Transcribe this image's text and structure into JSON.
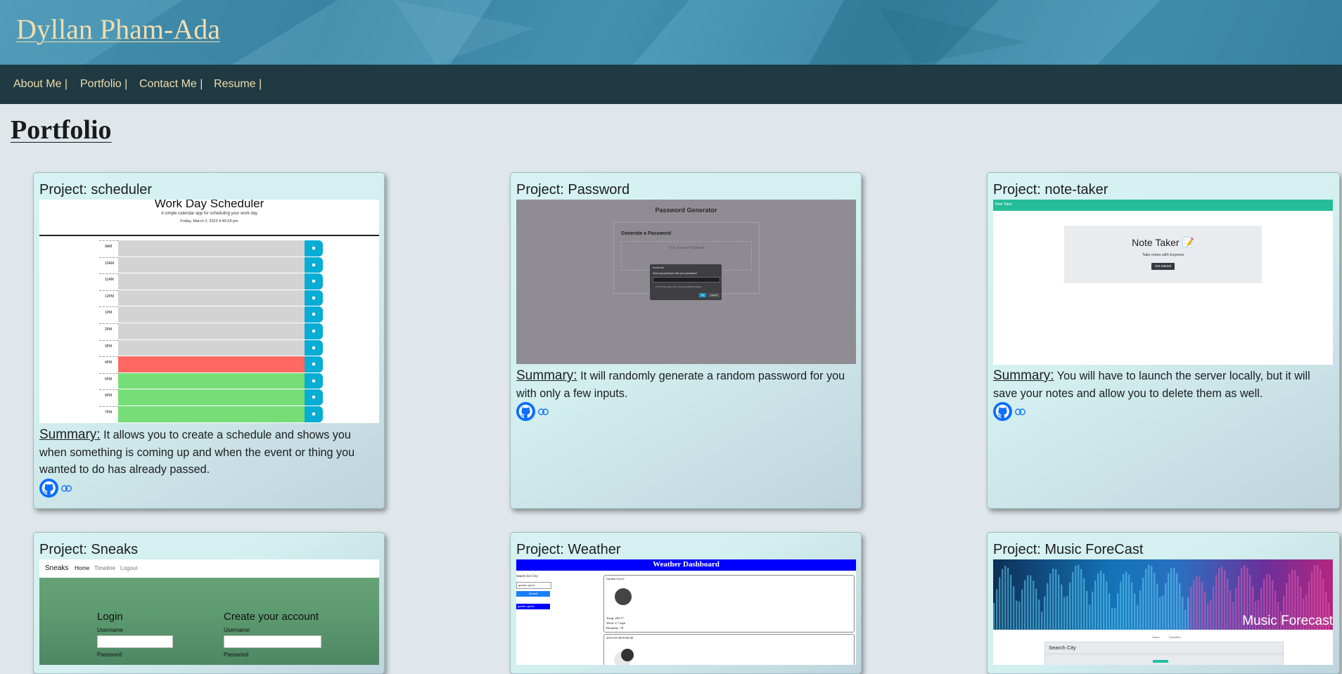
{
  "header": {
    "title": "Dyllan Pham-Ada"
  },
  "nav": [
    {
      "label": "About Me |"
    },
    {
      "label": "Portfolio |"
    },
    {
      "label": "Contact Me |"
    },
    {
      "label": "Resume |"
    }
  ],
  "page": {
    "heading": "Portfolio"
  },
  "projects": [
    {
      "title": "Project: scheduler",
      "summary_label": "Summary:",
      "summary": "It allows you to create a schedule and shows you when something is coming up and when the event or thing you wanted to do has already passed.",
      "preview": {
        "heading": "Work Day Scheduler",
        "lead": "A simple calendar app for scheduling your work day",
        "date": "Friday, March 3, 2023 4:49:24 pm",
        "hours": [
          "9AM",
          "10AM",
          "11AM",
          "12PM",
          "1PM",
          "2PM",
          "3PM",
          "4PM",
          "5PM",
          "6PM",
          "7PM"
        ]
      }
    },
    {
      "title": "Project: Password",
      "summary_label": "Summary:",
      "summary": "It will randomly generate a random password for you with only a few inputs.",
      "preview": {
        "heading": "Password Generator",
        "card_title": "Generate a Password",
        "placeholder": "Your Secure Password",
        "dialog_site": "localhost",
        "dialog_question": "How long would you like your password?",
        "dialog_checkbox": "Prevent this page from creating additional dialogs",
        "ok": "OK",
        "cancel": "Cancel"
      }
    },
    {
      "title": "Project: note-taker",
      "summary_label": "Summary:",
      "summary": "You will have to launch the server locally, but it will save your notes and allow you to delete them as well.",
      "preview": {
        "navbar": "Note Taker",
        "heading": "Note Taker 📝",
        "lead": "Take notes with Express",
        "button": "Get Started"
      }
    },
    {
      "title": "Project: Sneaks",
      "preview": {
        "brand": "Sneaks",
        "nav": [
          "Home",
          "Timeline",
          "Logout"
        ],
        "login": "Login",
        "create": "Create your account",
        "username": "Username",
        "password": "Password"
      }
    },
    {
      "title": "Project: Weather",
      "preview": {
        "banner": "Weather Dashboard",
        "search_label": "Search for City:",
        "search_value": "garden grove",
        "submit": "Submit",
        "history": "garden grove",
        "city": "Garden Grove",
        "temp": "Temp: 292.17",
        "wind": "Wind: 2.7 mph",
        "humidity": "Humidity: 78",
        "next_date": "2023-03-08 09:00:00"
      }
    },
    {
      "title": "Project: Music ForeCast",
      "preview": {
        "banner": "Music Forecast",
        "nav": [
          "Home",
          "Favorites"
        ],
        "search": "Search City"
      }
    }
  ],
  "colors": {
    "header_text": "#f1ddb0",
    "nav_bg": "#1f3a42",
    "past": "#ff6961",
    "future": "#77dd77",
    "save": "#06aed5"
  },
  "icons": {
    "github": "github-icon",
    "link": "link-icon"
  }
}
